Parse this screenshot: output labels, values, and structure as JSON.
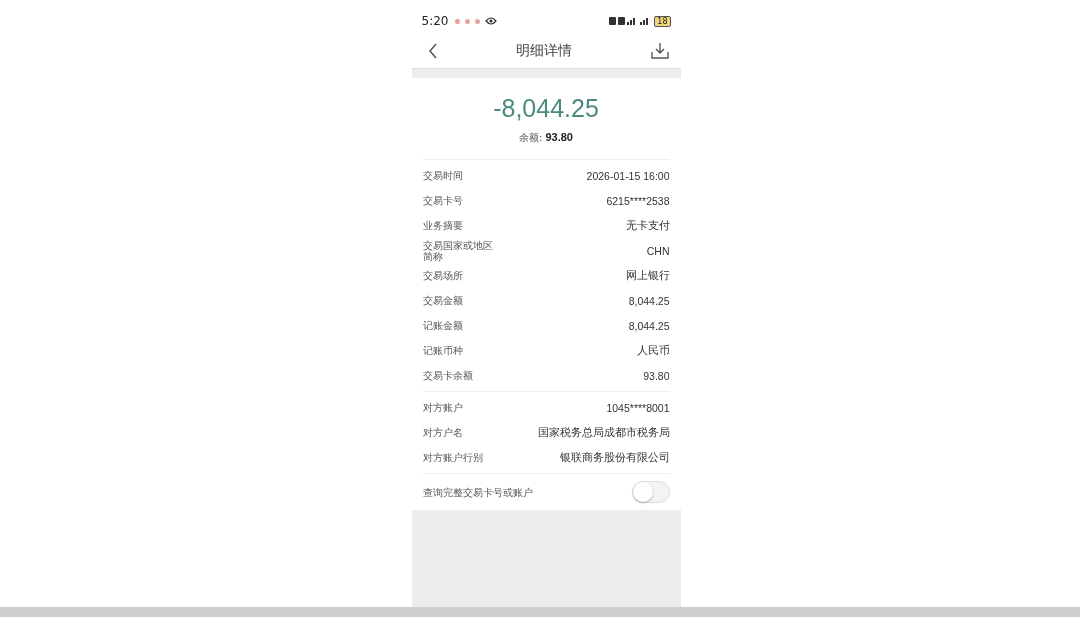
{
  "status_bar": {
    "time": "5:20",
    "battery": "18"
  },
  "header": {
    "title": "明细详情"
  },
  "summary": {
    "amount": "-8,044.25",
    "balance_label": "余额:",
    "balance_value": "93.80"
  },
  "detail_groups": [
    {
      "rows": [
        {
          "label": "交易时间",
          "value": "2026-01-15 16:00"
        },
        {
          "label": "交易卡号",
          "value": "6215****2538"
        },
        {
          "label": "业务摘要",
          "value": "无卡支付"
        },
        {
          "label": "交易国家或地区简称",
          "value": "CHN"
        },
        {
          "label": "交易场所",
          "value": "网上银行"
        },
        {
          "label": "交易金额",
          "value": "8,044.25"
        },
        {
          "label": "记账金额",
          "value": "8,044.25"
        },
        {
          "label": "记账币种",
          "value": "人民币"
        },
        {
          "label": "交易卡余额",
          "value": "93.80"
        }
      ]
    },
    {
      "rows": [
        {
          "label": "对方账户",
          "value": "1045****8001"
        },
        {
          "label": "对方户名",
          "value": "国家税务总局成都市税务局"
        },
        {
          "label": "对方账户行别",
          "value": "银联商务股份有限公司"
        }
      ]
    }
  ],
  "toggle": {
    "label": "查询完整交易卡号或账户",
    "on": false
  }
}
